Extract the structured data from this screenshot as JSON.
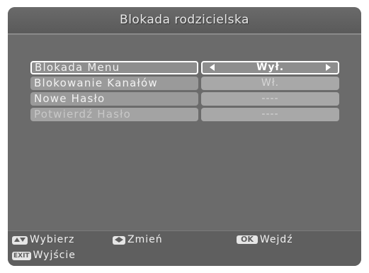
{
  "title": "Blokada rodzicielska",
  "menu": [
    {
      "label": "Blokada Menu",
      "value": "Wył.",
      "state": "selected"
    },
    {
      "label": "Blokowanie Kanałów",
      "value": "Wł.",
      "state": "normal"
    },
    {
      "label": "Nowe Hasło",
      "value": "----",
      "state": "normal"
    },
    {
      "label": "Potwierdź Hasło",
      "value": "----",
      "state": "disabled"
    }
  ],
  "footer": {
    "select_label": "Wybierz",
    "change_label": "Zmień",
    "enter_key": "OK",
    "enter_label": "Wejdź",
    "exit_key": "EXIT",
    "exit_label": "Wyjście",
    "select_icon": "up-down-arrows-icon",
    "change_icon": "left-right-arrows-icon"
  }
}
